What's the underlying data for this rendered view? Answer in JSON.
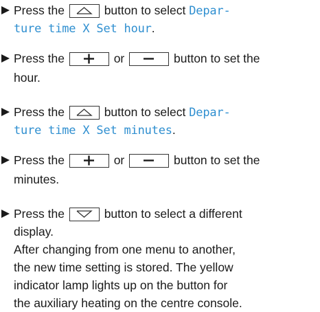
{
  "steps": [
    {
      "lines": [
        {
          "a": "Press the",
          "b": "button to select",
          "c": "Depar-"
        },
        {
          "d": "ture time X Set hour",
          "e": "."
        }
      ]
    },
    {
      "lines": [
        {
          "a": "Press the",
          "b": "or",
          "c": "button to set the"
        },
        {
          "d": "hour."
        }
      ]
    },
    {
      "lines": [
        {
          "a": "Press the",
          "b": "button to select",
          "c": "Depar-"
        },
        {
          "d": "ture time X Set minutes",
          "e": "."
        }
      ]
    },
    {
      "lines": [
        {
          "a": "Press the",
          "b": "or",
          "c": "button to set the"
        },
        {
          "d": "minutes."
        }
      ]
    },
    {
      "lines": [
        {
          "a": "Press the",
          "b": "button to select a different"
        },
        {
          "d": "display."
        }
      ]
    }
  ],
  "note": {
    "lines": [
      "After changing from one menu to another,",
      "the new time setting is stored. The yellow",
      "indicator lamp lights up on the button for",
      "the auxiliary heating on the centre console."
    ]
  },
  "icons": {
    "bullet": "triangle-right-icon",
    "up_key": "up-arrow-key-icon",
    "down_key": "down-arrow-key-icon",
    "plus_key": "plus-key-icon",
    "minus_key": "minus-key-icon"
  },
  "colors": {
    "display_text": "#2f8fd0",
    "body_text": "#1a1a1a"
  }
}
